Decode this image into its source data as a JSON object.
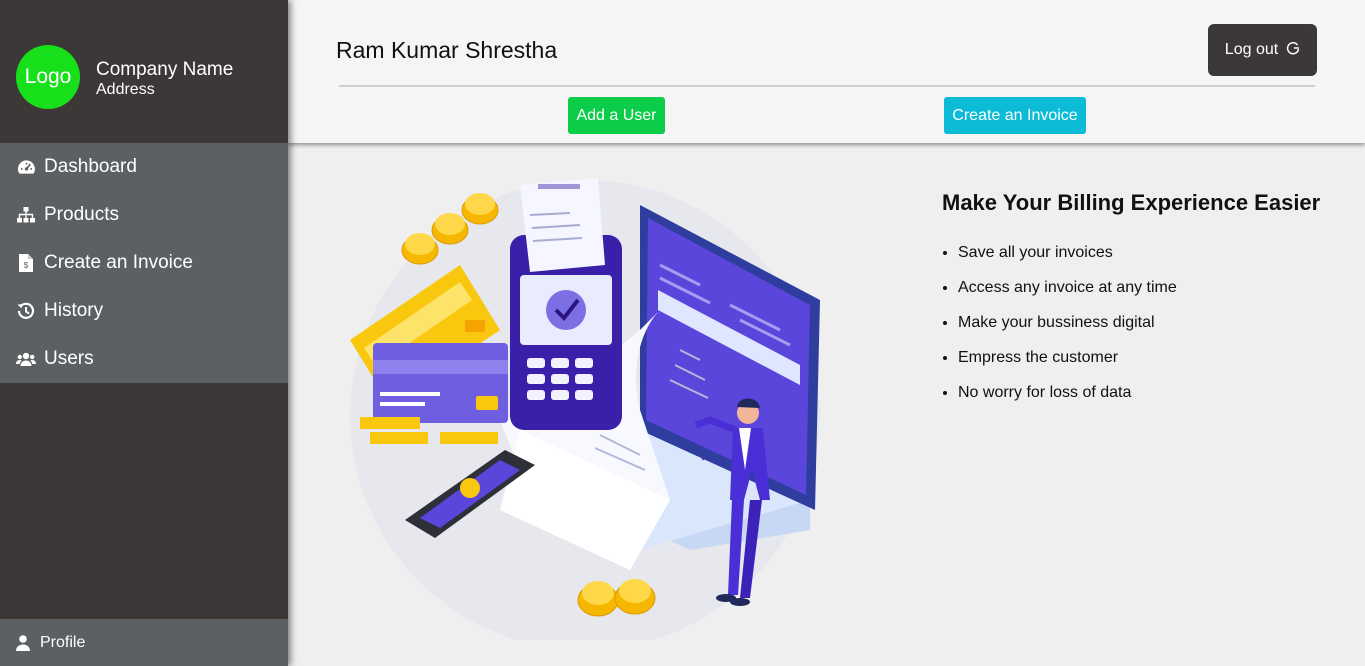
{
  "sidebar": {
    "logo": "Logo",
    "company_name": "Company Name",
    "address": "Address",
    "items": [
      {
        "label": "Dashboard",
        "icon": "dashboard-icon"
      },
      {
        "label": "Products",
        "icon": "sitemap-icon"
      },
      {
        "label": "Create an Invoice",
        "icon": "invoice-file-icon"
      },
      {
        "label": "History",
        "icon": "history-icon"
      },
      {
        "label": "Users",
        "icon": "users-icon"
      }
    ],
    "profile": {
      "label": "Profile",
      "icon": "user-icon"
    }
  },
  "header": {
    "user_name": "Ram Kumar Shrestha",
    "logout_label": "Log out",
    "add_user_label": "Add a User",
    "create_invoice_label": "Create an Invoice"
  },
  "main": {
    "heading": "Make Your Billing Experience Easier",
    "features": [
      "Save all your invoices",
      "Access any invoice at any time",
      "Make your bussiness digital",
      "Empress the customer",
      "No worry for loss of data"
    ]
  },
  "colors": {
    "sidebar_bg": "#3d3838",
    "menu_bg": "#5d6062",
    "logo_green": "#17e01b",
    "add_user_green": "#0ccd4a",
    "invoice_cyan": "#0cbcd6"
  }
}
